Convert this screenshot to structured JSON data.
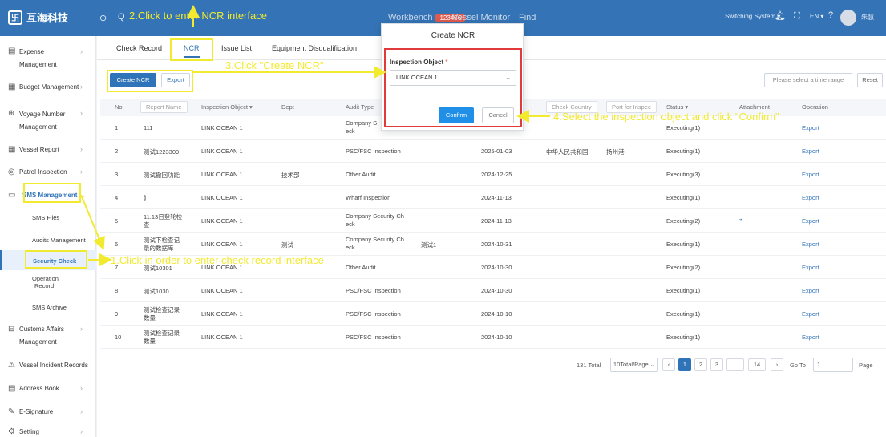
{
  "topbar": {
    "logo_text": "互海科技",
    "nav": {
      "workbench": "Workbench",
      "badge": "123456",
      "vessel_monitor": "Vessel Monitor",
      "find": "Find"
    },
    "switching_system": "Switching System ▾",
    "lang": "EN ▾",
    "user": "朱慧"
  },
  "sidebar": {
    "items": [
      {
        "label": "Expense",
        "label2": "Management"
      },
      {
        "label": "Budget Management"
      },
      {
        "label": "Voyage Number",
        "label2": "Management"
      },
      {
        "label": "Vessel Report"
      },
      {
        "label": "Patrol Inspection"
      },
      {
        "label": "SMS Management"
      },
      {
        "label": "Customs Affairs",
        "label2": "Management"
      },
      {
        "label": "Vessel Incident Records"
      },
      {
        "label": "Address Book"
      },
      {
        "label": "E-Signature"
      },
      {
        "label": "Setting"
      }
    ],
    "sub": {
      "sms_files": "SMS Files",
      "audits": "Audits Management",
      "security_check": "Security Check",
      "operation_record": "Operation",
      "operation_record2": "Record",
      "sms_archive": "SMS Archive"
    }
  },
  "tabs": [
    "Check Record",
    "NCR",
    "Issue List",
    "Equipment Disqualification"
  ],
  "toolbar": {
    "create": "Create NCR",
    "export": "Export",
    "time_range": "Please select a time range",
    "reset": "Reset"
  },
  "table": {
    "headers": {
      "no": "No.",
      "report": "Report Name",
      "object": "Inspection Object ▾",
      "dept": "Dept",
      "audit": "Audit Type",
      "check_country": "Check Country",
      "port": "Port for Inspec",
      "status": "Status ▾",
      "attachment": "Attachment",
      "operation": "Operation"
    },
    "rows": [
      {
        "no": "1",
        "name": "111",
        "name2": "",
        "object": "LINK OCEAN 1",
        "dept": "",
        "audit": "Company S",
        "audit2": "eck",
        "extra": "",
        "date": "2025-01-13",
        "country": "",
        "port": "",
        "status": "Executing(1)",
        "op": "Export"
      },
      {
        "no": "2",
        "name": "测试1223309",
        "name2": "",
        "object": "LINK OCEAN 1",
        "dept": "",
        "audit": "PSC/FSC Inspection",
        "audit2": "",
        "extra": "",
        "date": "2025-01-03",
        "country": "中华人民共和国",
        "port": "扬州港",
        "status": "Executing(1)",
        "op": "Export"
      },
      {
        "no": "3",
        "name": "测试撤回功能",
        "name2": "",
        "object": "LINK OCEAN 1",
        "dept": "技术部",
        "audit": "Other Audit",
        "audit2": "",
        "extra": "",
        "date": "2024-12-25",
        "country": "",
        "port": "",
        "status": "Executing(3)",
        "op": "Export"
      },
      {
        "no": "4",
        "name": "】",
        "name2": "",
        "object": "LINK OCEAN 1",
        "dept": "",
        "audit": "Wharf Inspection",
        "audit2": "",
        "extra": "",
        "date": "2024-11-13",
        "country": "",
        "port": "",
        "status": "Executing(1)",
        "op": "Export"
      },
      {
        "no": "5",
        "name": "11.13日登轮检",
        "name2": "查",
        "object": "LINK OCEAN 1",
        "dept": "",
        "audit": "Company Security Ch",
        "audit2": "eck",
        "extra": "",
        "date": "2024-11-13",
        "country": "",
        "port": "",
        "status": "Executing(2)",
        "op": "Export"
      },
      {
        "no": "6",
        "name": "测试下检查记",
        "name2": "录的数据库",
        "object": "LINK OCEAN 1",
        "dept": "测试",
        "audit": "Company Security Ch",
        "audit2": "eck",
        "extra": "测试1",
        "date": "2024-10-31",
        "country": "",
        "port": "",
        "status": "Executing(1)",
        "op": "Export"
      },
      {
        "no": "7",
        "name": "测试10301",
        "name2": "",
        "object": "LINK OCEAN 1",
        "dept": "",
        "audit": "Other Audit",
        "audit2": "",
        "extra": "",
        "date": "2024-10-30",
        "country": "",
        "port": "",
        "status": "Executing(2)",
        "op": "Export"
      },
      {
        "no": "8",
        "name": "测试1030",
        "name2": "",
        "object": "LINK OCEAN 1",
        "dept": "",
        "audit": "PSC/FSC Inspection",
        "audit2": "",
        "extra": "",
        "date": "2024-10-30",
        "country": "",
        "port": "",
        "status": "Executing(1)",
        "op": "Export"
      },
      {
        "no": "9",
        "name": "测试检查记录",
        "name2": "数量",
        "object": "LINK OCEAN 1",
        "dept": "",
        "audit": "PSC/FSC Inspection",
        "audit2": "",
        "extra": "",
        "date": "2024-10-10",
        "country": "",
        "port": "",
        "status": "Executing(1)",
        "op": "Export"
      },
      {
        "no": "10",
        "name": "测试检查记录",
        "name2": "数量",
        "object": "LINK OCEAN 1",
        "dept": "",
        "audit": "PSC/FSC Inspection",
        "audit2": "",
        "extra": "",
        "date": "2024-10-10",
        "country": "",
        "port": "",
        "status": "Executing(1)",
        "op": "Export"
      }
    ]
  },
  "pagination": {
    "total": "131 Total",
    "per_page": "10Total/Page",
    "pages": [
      "1",
      "2",
      "3",
      "...",
      "14"
    ],
    "goto": "Go To",
    "goto_value": "1",
    "page_word": "Page"
  },
  "modal": {
    "title": "Create NCR",
    "label": "Inspection Object",
    "required": "*",
    "selected": "LINK OCEAN 1",
    "confirm": "Confirm",
    "cancel": "Cancel"
  },
  "annotations": {
    "step1": "1.Click in order to enter check record interface",
    "step2": "2.Click to enter NCR interface",
    "step3": "3.Click \"Create NCR\"",
    "step4": "4.Select the inspection object and click \"Confirm\""
  },
  "colors": {
    "brand": "#3474b6",
    "annotation": "#f2ea2e",
    "highlight_red": "#e03a3a",
    "confirm": "#1f8fe8"
  }
}
